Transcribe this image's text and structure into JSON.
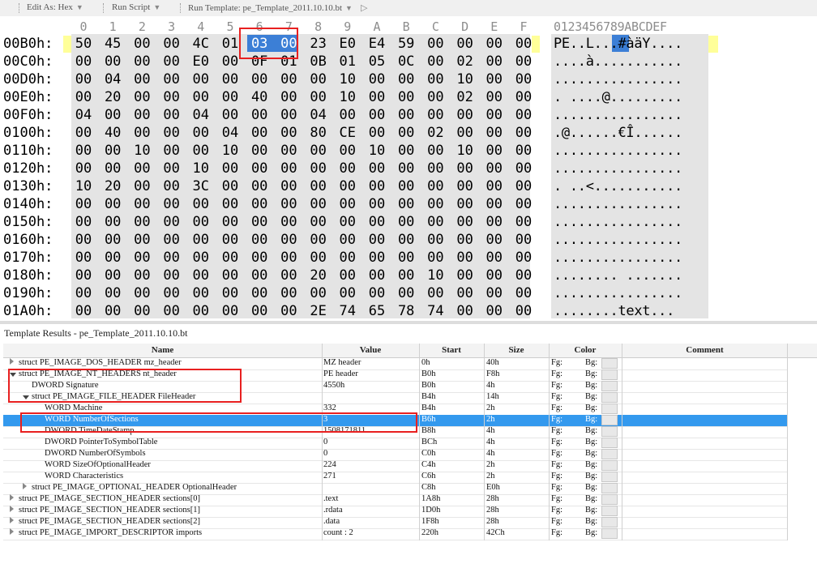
{
  "toolbar": {
    "edit_as": "Edit As: Hex",
    "run_script": "Run Script",
    "run_template": "Run Template: pe_Template_2011.10.10.bt"
  },
  "hex": {
    "columns": [
      "0",
      "1",
      "2",
      "3",
      "4",
      "5",
      "6",
      "7",
      "8",
      "9",
      "A",
      "B",
      "C",
      "D",
      "E",
      "F"
    ],
    "ascii_header": "0123456789ABCDEF",
    "rows": [
      {
        "addr": "00B0h:",
        "bytes": [
          "50",
          "45",
          "00",
          "00",
          "4C",
          "01",
          "03",
          "00",
          "23",
          "E0",
          "E4",
          "59",
          "00",
          "00",
          "00",
          "00"
        ],
        "ascii": "PE..L...#àäY...."
      },
      {
        "addr": "00C0h:",
        "bytes": [
          "00",
          "00",
          "00",
          "00",
          "E0",
          "00",
          "0F",
          "01",
          "0B",
          "01",
          "05",
          "0C",
          "00",
          "02",
          "00",
          "00"
        ],
        "ascii": "....à..........."
      },
      {
        "addr": "00D0h:",
        "bytes": [
          "00",
          "04",
          "00",
          "00",
          "00",
          "00",
          "00",
          "00",
          "00",
          "10",
          "00",
          "00",
          "00",
          "10",
          "00",
          "00"
        ],
        "ascii": "................"
      },
      {
        "addr": "00E0h:",
        "bytes": [
          "00",
          "20",
          "00",
          "00",
          "00",
          "00",
          "40",
          "00",
          "00",
          "10",
          "00",
          "00",
          "00",
          "02",
          "00",
          "00"
        ],
        "ascii": ". ....@........."
      },
      {
        "addr": "00F0h:",
        "bytes": [
          "04",
          "00",
          "00",
          "00",
          "04",
          "00",
          "00",
          "00",
          "04",
          "00",
          "00",
          "00",
          "00",
          "00",
          "00",
          "00"
        ],
        "ascii": "................"
      },
      {
        "addr": "0100h:",
        "bytes": [
          "00",
          "40",
          "00",
          "00",
          "00",
          "04",
          "00",
          "00",
          "80",
          "CE",
          "00",
          "00",
          "02",
          "00",
          "00",
          "00"
        ],
        "ascii": ".@......€Î......"
      },
      {
        "addr": "0110h:",
        "bytes": [
          "00",
          "00",
          "10",
          "00",
          "00",
          "10",
          "00",
          "00",
          "00",
          "00",
          "10",
          "00",
          "00",
          "10",
          "00",
          "00"
        ],
        "ascii": "................"
      },
      {
        "addr": "0120h:",
        "bytes": [
          "00",
          "00",
          "00",
          "00",
          "10",
          "00",
          "00",
          "00",
          "00",
          "00",
          "00",
          "00",
          "00",
          "00",
          "00",
          "00"
        ],
        "ascii": "................"
      },
      {
        "addr": "0130h:",
        "bytes": [
          "10",
          "20",
          "00",
          "00",
          "3C",
          "00",
          "00",
          "00",
          "00",
          "00",
          "00",
          "00",
          "00",
          "00",
          "00",
          "00"
        ],
        "ascii": ". ..<..........."
      },
      {
        "addr": "0140h:",
        "bytes": [
          "00",
          "00",
          "00",
          "00",
          "00",
          "00",
          "00",
          "00",
          "00",
          "00",
          "00",
          "00",
          "00",
          "00",
          "00",
          "00"
        ],
        "ascii": "................"
      },
      {
        "addr": "0150h:",
        "bytes": [
          "00",
          "00",
          "00",
          "00",
          "00",
          "00",
          "00",
          "00",
          "00",
          "00",
          "00",
          "00",
          "00",
          "00",
          "00",
          "00"
        ],
        "ascii": "................"
      },
      {
        "addr": "0160h:",
        "bytes": [
          "00",
          "00",
          "00",
          "00",
          "00",
          "00",
          "00",
          "00",
          "00",
          "00",
          "00",
          "00",
          "00",
          "00",
          "00",
          "00"
        ],
        "ascii": "................"
      },
      {
        "addr": "0170h:",
        "bytes": [
          "00",
          "00",
          "00",
          "00",
          "00",
          "00",
          "00",
          "00",
          "00",
          "00",
          "00",
          "00",
          "00",
          "00",
          "00",
          "00"
        ],
        "ascii": "................"
      },
      {
        "addr": "0180h:",
        "bytes": [
          "00",
          "00",
          "00",
          "00",
          "00",
          "00",
          "00",
          "00",
          "20",
          "00",
          "00",
          "00",
          "10",
          "00",
          "00",
          "00"
        ],
        "ascii": "........ ......."
      },
      {
        "addr": "0190h:",
        "bytes": [
          "00",
          "00",
          "00",
          "00",
          "00",
          "00",
          "00",
          "00",
          "00",
          "00",
          "00",
          "00",
          "00",
          "00",
          "00",
          "00"
        ],
        "ascii": "................"
      },
      {
        "addr": "01A0h:",
        "bytes": [
          "00",
          "00",
          "00",
          "00",
          "00",
          "00",
          "00",
          "00",
          "2E",
          "74",
          "65",
          "78",
          "74",
          "00",
          "00",
          "00"
        ],
        "ascii": "........text..."
      }
    ]
  },
  "results": {
    "title": "Template Results - pe_Template_2011.10.10.bt",
    "headers": {
      "name": "Name",
      "value": "Value",
      "start": "Start",
      "size": "Size",
      "color": "Color",
      "comment": "Comment"
    },
    "fg_label": "Fg:",
    "bg_label": "Bg:",
    "rows": [
      {
        "name": "struct PE_IMAGE_DOS_HEADER mz_header",
        "value": "MZ header",
        "start": "0h",
        "size": "40h"
      },
      {
        "name": "struct PE_IMAGE_NT_HEADERS nt_header",
        "value": "PE header",
        "start": "B0h",
        "size": "F8h"
      },
      {
        "name": "DWORD Signature",
        "value": "4550h",
        "start": "B0h",
        "size": "4h"
      },
      {
        "name": "struct PE_IMAGE_FILE_HEADER FileHeader",
        "value": "",
        "start": "B4h",
        "size": "14h"
      },
      {
        "name": "WORD Machine",
        "value": "332",
        "start": "B4h",
        "size": "2h"
      },
      {
        "name": "WORD NumberOfSections",
        "value": "3",
        "start": "B6h",
        "size": "2h"
      },
      {
        "name": "DWORD TimeDateStamp",
        "value": "1508171811",
        "start": "B8h",
        "size": "4h"
      },
      {
        "name": "DWORD PointerToSymbolTable",
        "value": "0",
        "start": "BCh",
        "size": "4h"
      },
      {
        "name": "DWORD NumberOfSymbols",
        "value": "0",
        "start": "C0h",
        "size": "4h"
      },
      {
        "name": "WORD SizeOfOptionalHeader",
        "value": "224",
        "start": "C4h",
        "size": "2h"
      },
      {
        "name": "WORD Characteristics",
        "value": "271",
        "start": "C6h",
        "size": "2h"
      },
      {
        "name": "struct PE_IMAGE_OPTIONAL_HEADER OptionalHeader",
        "value": "",
        "start": "C8h",
        "size": "E0h"
      },
      {
        "name": "struct PE_IMAGE_SECTION_HEADER sections[0]",
        "value": ".text",
        "start": "1A8h",
        "size": "28h"
      },
      {
        "name": "struct PE_IMAGE_SECTION_HEADER sections[1]",
        "value": ".rdata",
        "start": "1D0h",
        "size": "28h"
      },
      {
        "name": "struct PE_IMAGE_SECTION_HEADER sections[2]",
        "value": ".data",
        "start": "1F8h",
        "size": "28h"
      },
      {
        "name": "struct PE_IMAGE_IMPORT_DESCRIPTOR imports",
        "value": "count : 2",
        "start": "220h",
        "size": "42Ch"
      }
    ]
  },
  "colors": {
    "selection": "#3c7fd6",
    "highlight_box": "#e82020",
    "hex_bg": "#e4e4e4",
    "row_selected": "#3399ee"
  }
}
